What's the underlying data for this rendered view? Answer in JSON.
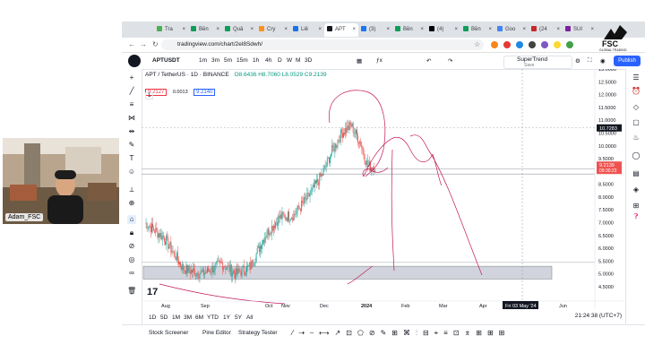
{
  "browser": {
    "tabs": [
      {
        "label": "Tra",
        "color": "#4caf50"
      },
      {
        "label": "Bền",
        "color": "#0f9d58"
      },
      {
        "label": "Quả",
        "color": "#0f9d58"
      },
      {
        "label": "Cry",
        "color": "#f7931a"
      },
      {
        "label": "Liê",
        "color": "#1a73e8"
      },
      {
        "label": "APT",
        "color": "#131722"
      },
      {
        "label": "(3)",
        "color": "#1877f2"
      },
      {
        "label": "Bền",
        "color": "#0f9d58"
      },
      {
        "label": "(4)",
        "color": "#000000"
      },
      {
        "label": "Bền",
        "color": "#0f9d58"
      },
      {
        "label": "Goo",
        "color": "#4285f4"
      },
      {
        "label": "(24",
        "color": "#c62828"
      },
      {
        "label": "SUI",
        "color": "#7b1fa2"
      }
    ],
    "url": "tradingview.com/chart/2el8Sdwh/"
  },
  "toolbar": {
    "symbol": "APTUSDT",
    "timeframes": [
      "1m",
      "3m",
      "5m",
      "15m",
      "1h",
      "4h",
      "D",
      "W",
      "M",
      "3D"
    ],
    "indicator": "SuperTrend",
    "indicator_sub": "Save",
    "publish": "Publish"
  },
  "legend": {
    "title": "APT / TetherUS · 1D · BINANCE",
    "ohlc": "O8.6436 H8.7060 L8.0529 C9.2139",
    "price1": "9.2127",
    "price2": "0.0013",
    "price3": "9.2140",
    "indicator_count": "1"
  },
  "price_axis": {
    "labels": [
      "13.0000",
      "12.5000",
      "12.0000",
      "11.5000",
      "11.0000",
      "10.5000",
      "10.0000",
      "9.5000",
      "9.0000",
      "8.5000",
      "8.0000",
      "7.5000",
      "7.0000",
      "6.5000",
      "6.0000",
      "5.5000",
      "5.0000",
      "4.5000"
    ],
    "marker1": "10.7283",
    "current_price": "9.2139",
    "countdown": "09:30:23"
  },
  "time_axis": {
    "labels": [
      "Aug",
      "Sep",
      "Oct",
      "Nov",
      "Dec",
      "2024",
      "Feb",
      "Mar",
      "Apr",
      "Jun"
    ],
    "crosshair": "Fri 03 May '24"
  },
  "ranges": {
    "buttons": [
      "1D",
      "5D",
      "1M",
      "3M",
      "6M",
      "YTD",
      "1Y",
      "5Y",
      "All"
    ],
    "clock": "21:24:38 (UTC+7)"
  },
  "bottombar": {
    "tabs": [
      "Stock Screener",
      "Pine Editor",
      "Strategy Tester"
    ]
  },
  "webcam": {
    "name": "Adam_FSC"
  },
  "logo": {
    "text": "FSC",
    "sub": "GLOBAL TRADING"
  },
  "colors": {
    "up": "#26a69a",
    "down": "#ef5350",
    "accent": "#2962ff",
    "drawing": "#c2185b"
  }
}
